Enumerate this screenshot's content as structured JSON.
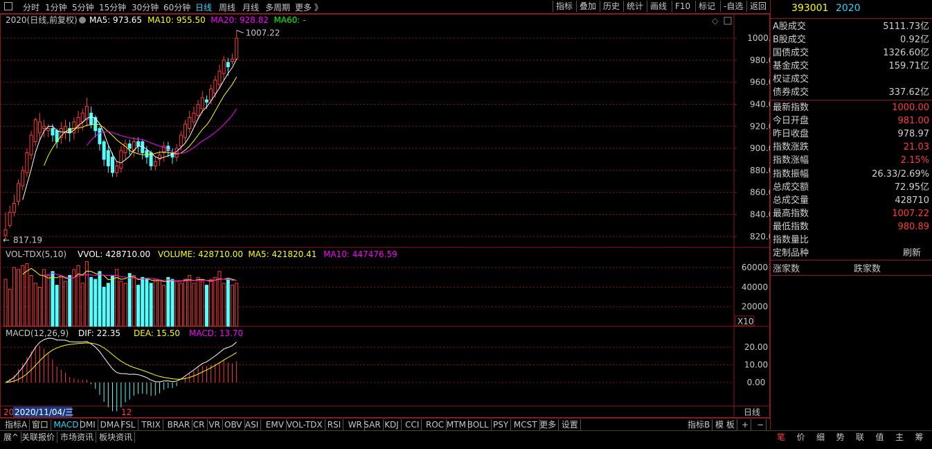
{
  "toolbar": {
    "periods": [
      "分时",
      "1分钟",
      "5分钟",
      "15分钟",
      "30分钟",
      "60分钟",
      "日线",
      "周线",
      "月线",
      "多周期",
      "更多 》"
    ],
    "active_period": "日线",
    "right_buttons": [
      "指标",
      "叠加",
      "历史",
      "统计",
      "画线",
      "F10",
      "标记",
      "-自选",
      "返回"
    ]
  },
  "main_chart": {
    "title": "2020(日线,前复权)",
    "ma_labels": [
      {
        "text": "MA5: 973.65",
        "color": "#ffffff"
      },
      {
        "text": "MA10: 955.50",
        "color": "#ffff00"
      },
      {
        "text": "MA20: 928.82",
        "color": "#ff00ff"
      },
      {
        "text": "MA60: -",
        "color": "#00ff00"
      }
    ],
    "high_label": "1007.22",
    "low_label": "817.19",
    "price_ticks": [
      "1000.00",
      "980.00",
      "960.00",
      "940.00",
      "920.00",
      "900.00",
      "880.00",
      "860.00",
      "840.00",
      "820.00"
    ]
  },
  "volume_chart": {
    "title": "VOL-TDX(5,10)",
    "labels": [
      {
        "text": "VVOL: 428710.00",
        "color": "#ffffff"
      },
      {
        "text": "VOLUME: 428710.00",
        "color": "#ffff00"
      },
      {
        "text": "MA5: 421820.41",
        "color": "#ffff00"
      },
      {
        "text": "MA10: 447476.59",
        "color": "#ff00ff"
      }
    ],
    "ticks": [
      "60000",
      "40000",
      "20000"
    ],
    "unit": "X10"
  },
  "macd_chart": {
    "title": "MACD(12,26,9)",
    "labels": [
      {
        "text": "DIF: 22.35",
        "color": "#ffffff"
      },
      {
        "text": "DEA: 15.50",
        "color": "#ffff00"
      },
      {
        "text": "MACD: 13.70",
        "color": "#ff00ff"
      }
    ],
    "ticks": [
      "20.00",
      "10.00",
      "0.00"
    ]
  },
  "axis": {
    "date_cursor": "2020/11/04/三",
    "year_left": "20",
    "month_mark": "12",
    "period_label": "日线"
  },
  "candles": [
    [
      826,
      821,
      842,
      817.19
    ],
    [
      842,
      830,
      848,
      828
    ],
    [
      850,
      842,
      858,
      838
    ],
    [
      868,
      852,
      872,
      848
    ],
    [
      880,
      866,
      884,
      862
    ],
    [
      896,
      878,
      900,
      874
    ],
    [
      912,
      894,
      916,
      890
    ],
    [
      926,
      906,
      928,
      902
    ],
    [
      924,
      914,
      932,
      908
    ],
    [
      920,
      918,
      926,
      910
    ],
    [
      918,
      916,
      922,
      910
    ],
    [
      912,
      918,
      922,
      906
    ],
    [
      906,
      916,
      918,
      900
    ],
    [
      918,
      910,
      924,
      904
    ],
    [
      920,
      914,
      926,
      908
    ],
    [
      914,
      918,
      924,
      906
    ],
    [
      924,
      914,
      928,
      908
    ],
    [
      928,
      920,
      934,
      914
    ],
    [
      932,
      924,
      936,
      916
    ],
    [
      938,
      926,
      946,
      920
    ],
    [
      922,
      932,
      938,
      918
    ],
    [
      916,
      928,
      930,
      910
    ],
    [
      904,
      918,
      920,
      898
    ],
    [
      890,
      906,
      908,
      884
    ],
    [
      884,
      898,
      902,
      878
    ],
    [
      878,
      892,
      896,
      874
    ],
    [
      884,
      878,
      888,
      874
    ],
    [
      898,
      882,
      902,
      878
    ],
    [
      904,
      896,
      908,
      890
    ],
    [
      900,
      904,
      908,
      894
    ],
    [
      906,
      898,
      910,
      892
    ],
    [
      902,
      906,
      910,
      896
    ],
    [
      896,
      906,
      908,
      890
    ],
    [
      892,
      898,
      902,
      886
    ],
    [
      884,
      896,
      898,
      880
    ],
    [
      888,
      884,
      892,
      880
    ],
    [
      894,
      890,
      898,
      884
    ],
    [
      902,
      896,
      906,
      888
    ],
    [
      898,
      902,
      906,
      892
    ],
    [
      892,
      896,
      900,
      886
    ],
    [
      900,
      892,
      904,
      888
    ],
    [
      912,
      902,
      916,
      898
    ],
    [
      922,
      910,
      926,
      906
    ],
    [
      928,
      918,
      934,
      914
    ],
    [
      932,
      924,
      938,
      920
    ],
    [
      940,
      930,
      944,
      926
    ],
    [
      946,
      936,
      952,
      932
    ],
    [
      942,
      944,
      948,
      936
    ],
    [
      954,
      944,
      958,
      940
    ],
    [
      962,
      950,
      966,
      946
    ],
    [
      970,
      958,
      976,
      954
    ],
    [
      980,
      968,
      984,
      962
    ],
    [
      974,
      978,
      982,
      966
    ],
    [
      981,
      978.97,
      986,
      976
    ],
    [
      1000,
      981,
      1007.22,
      980.89
    ]
  ],
  "volumes": [
    48,
    38,
    60,
    58,
    62,
    64,
    52,
    44,
    40,
    58,
    52,
    56,
    42,
    50,
    46,
    52,
    58,
    62,
    44,
    66,
    50,
    48,
    56,
    40,
    44,
    52,
    58,
    46,
    44,
    54,
    52,
    42,
    50,
    48,
    44,
    48,
    46,
    42,
    50,
    48,
    46,
    44,
    48,
    52,
    44,
    50,
    46,
    42,
    48,
    50,
    56,
    44,
    48,
    42,
    44
  ],
  "quotes": {
    "code": "393001",
    "name": "2020",
    "turnover": [
      {
        "label": "A股成交",
        "value": "5111.73亿"
      },
      {
        "label": "B股成交",
        "value": "0.92亿"
      },
      {
        "label": "国债成交",
        "value": "1326.60亿"
      },
      {
        "label": "基金成交",
        "value": "159.71亿"
      },
      {
        "label": "权证成交",
        "value": ""
      },
      {
        "label": "债券成交",
        "value": "337.62亿"
      }
    ],
    "index": [
      {
        "label": "最新指数",
        "value": "1000.00",
        "red": true
      },
      {
        "label": "今日开盘",
        "value": "981.00",
        "red": true
      },
      {
        "label": "昨日收盘",
        "value": "978.97",
        "red": false
      },
      {
        "label": "指数涨跌",
        "value": "21.03",
        "red": true
      },
      {
        "label": "指数涨幅",
        "value": "2.15%",
        "red": true
      },
      {
        "label": "指数振幅",
        "value": "26.33/2.69%",
        "red": false
      },
      {
        "label": "总成交额",
        "value": "72.95亿",
        "red": false
      },
      {
        "label": "总成交量",
        "value": "428710",
        "red": false
      },
      {
        "label": "最高指数",
        "value": "1007.22",
        "red": true
      },
      {
        "label": "最低指数",
        "value": "980.89",
        "red": true
      },
      {
        "label": "指数量比",
        "value": "",
        "red": false
      },
      {
        "label": "定制品种",
        "value": "刷新",
        "red": false
      }
    ],
    "rise_label": "涨家数",
    "fall_label": "跌家数"
  },
  "bottom_tabs": [
    "指标A",
    "窗口",
    "MACD",
    "DMI",
    "DMA",
    "FSL",
    "TRIX",
    "BRAR",
    "CR",
    "VR",
    "OBV",
    "ASI",
    "EMV",
    "VOL-TDX",
    "RSI",
    "WR",
    "SAR",
    "KDJ",
    "CCI",
    "ROC",
    "MTM",
    "BOLL",
    "PSY",
    "MCST",
    "更多",
    "设置"
  ],
  "active_tab": "MACD",
  "bottom_right": [
    "指标B",
    "模 板",
    "+",
    "−"
  ],
  "status_left": [
    "展^",
    "关联报价",
    "市场资讯",
    "板块资讯"
  ],
  "right_tabs": [
    "笔",
    "价",
    "细",
    "势",
    "联",
    "值",
    "主",
    "筹"
  ],
  "colors": {
    "up": "#ff3c3c",
    "down": "#54ffff",
    "grid": "#8b1a1a",
    "accent": "#2ad4ff"
  }
}
